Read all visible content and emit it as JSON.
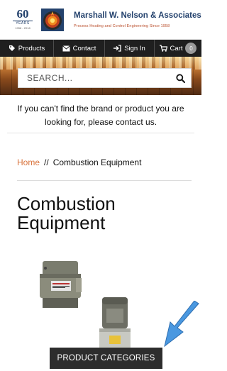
{
  "header": {
    "anniversary": {
      "number": "60",
      "word": "YEARS",
      "range": "1958 - 2018"
    },
    "company_name": "Marshall W. Nelson & Associates",
    "tagline": "Process Heating and Control Engineering Since 1958"
  },
  "nav": {
    "items": [
      {
        "label": "Products",
        "icon": "tag-icon"
      },
      {
        "label": "Contact",
        "icon": "envelope-icon"
      },
      {
        "label": "Sign In",
        "icon": "sign-in-icon"
      },
      {
        "label": "Cart",
        "icon": "cart-icon"
      }
    ],
    "cart_count": "0"
  },
  "search": {
    "placeholder": "SEARCH..."
  },
  "notice": "If you can't find the brand or product you are looking for, please contact us.",
  "breadcrumb": {
    "home": "Home",
    "separator": "//",
    "current": "Combustion Equipment"
  },
  "page_title": "Combustion Equipment",
  "categories_tab": "PRODUCT CATEGORIES",
  "colors": {
    "brand_blue": "#24426d",
    "accent_orange": "#d9733c",
    "nav_bg": "#1f1f1f",
    "arrow_blue": "#4a98e0"
  }
}
